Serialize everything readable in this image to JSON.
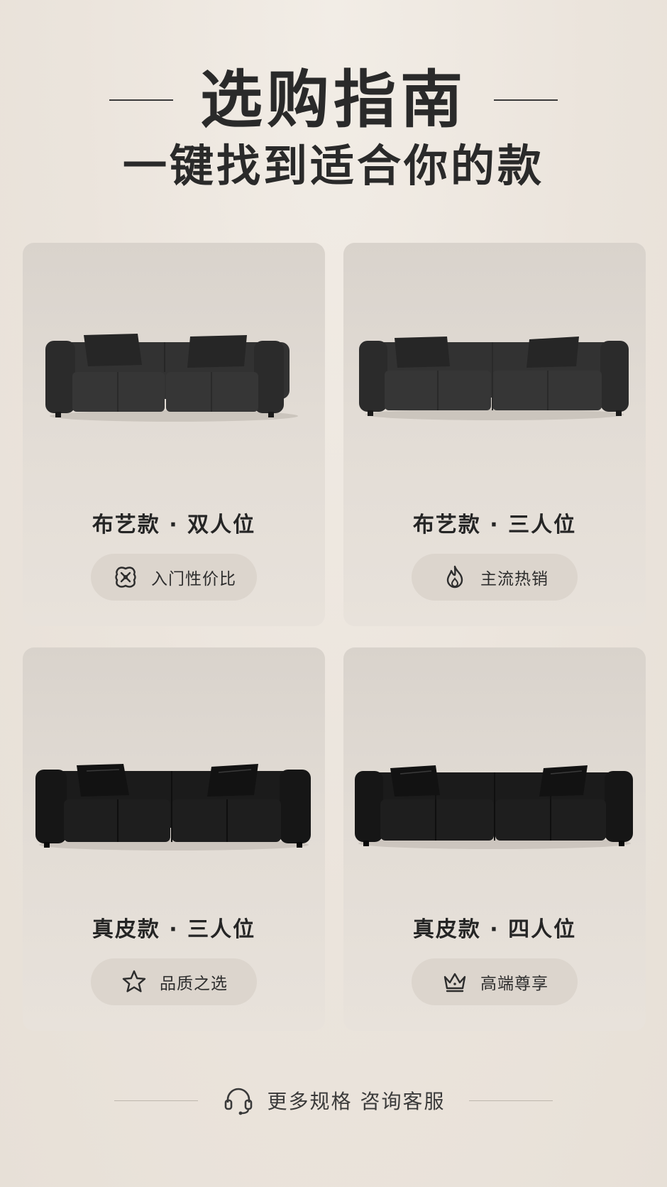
{
  "header": {
    "title": "选购指南",
    "subtitle": "一键找到适合你的款"
  },
  "cards": [
    {
      "title": "布艺款 · 双人位",
      "tag": "入门性价比",
      "tag_icon": "value-badge-icon",
      "material": "fabric",
      "seats": 2
    },
    {
      "title": "布艺款 · 三人位",
      "tag": "主流热销",
      "tag_icon": "flame-icon",
      "material": "fabric",
      "seats": 3
    },
    {
      "title": "真皮款 · 三人位",
      "tag": "品质之选",
      "tag_icon": "star-icon",
      "material": "leather",
      "seats": 3
    },
    {
      "title": "真皮款 · 四人位",
      "tag": "高端尊享",
      "tag_icon": "crown-icon",
      "material": "leather",
      "seats": 4
    }
  ],
  "footer": {
    "text": "更多规格  咨询客服",
    "icon": "headset-icon"
  },
  "colors": {
    "background": "#ebe4dc",
    "card": "#e2dcd5",
    "pill": "#dcd5cd",
    "text": "#2a2a2a",
    "fabric_sofa": "#2e2e2e",
    "leather_sofa": "#151515"
  }
}
